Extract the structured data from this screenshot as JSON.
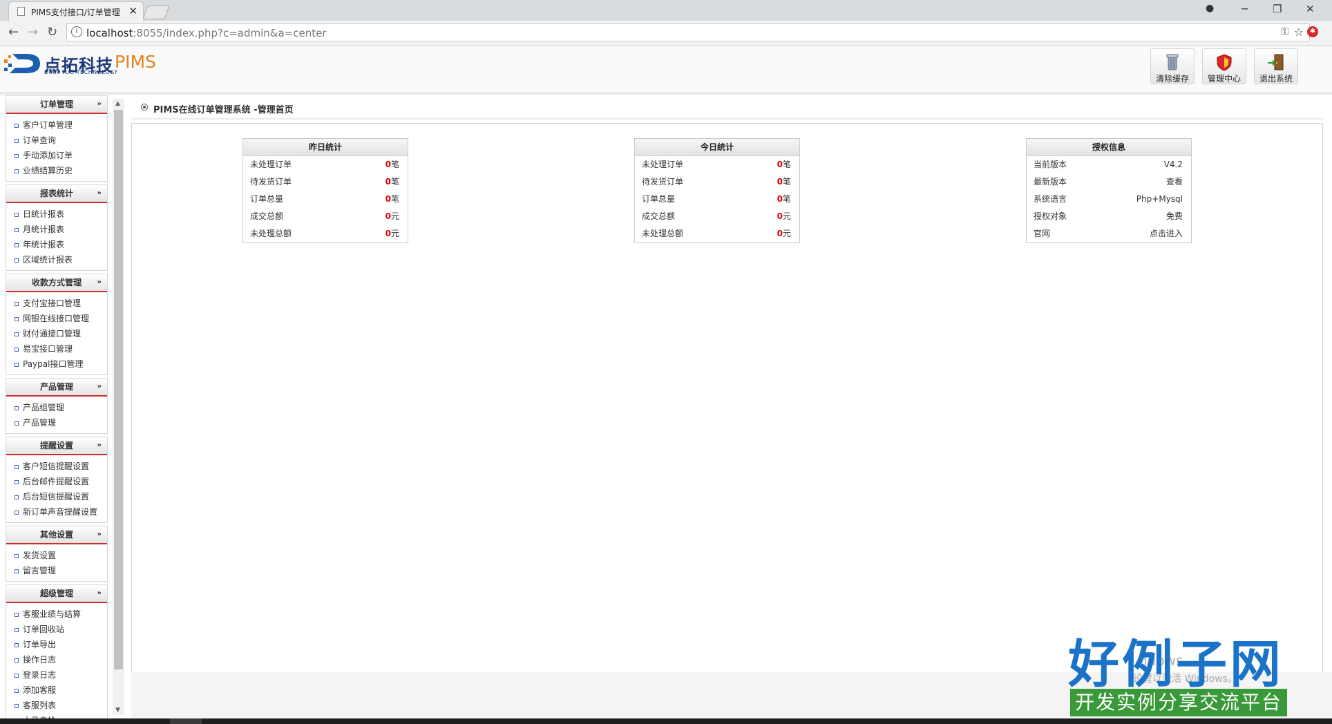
{
  "browser": {
    "tab_title": "PIMS支付接口/订单管理",
    "tab_close": "✕",
    "url_host": "localhost",
    "url_rest": ":8055/index.php?c=admin&a=center",
    "win_min": "─",
    "win_max": "❐",
    "win_close": "✕",
    "back": "←",
    "forward": "→",
    "reload": "↻",
    "info": "i",
    "key": "⚿",
    "star": "☆",
    "ext": "✱"
  },
  "header": {
    "logo_cn": "点拓科技",
    "logo_pims": "PIMS",
    "logo_en": "DIAN TUO TECHNOLOGY",
    "buttons": [
      {
        "label": "清除缓存",
        "icon": "trash-icon"
      },
      {
        "label": "管理中心",
        "icon": "shield-icon"
      },
      {
        "label": "退出系统",
        "icon": "exit-door-icon"
      }
    ]
  },
  "sidebar": {
    "groups": [
      {
        "title": "订单管理",
        "items": [
          "客户订单管理",
          "订单查询",
          "手动添加订单",
          "业绩结算历史"
        ]
      },
      {
        "title": "报表统计",
        "items": [
          "日统计报表",
          "月统计报表",
          "年统计报表",
          "区域统计报表"
        ]
      },
      {
        "title": "收款方式管理",
        "items": [
          "支付宝接口管理",
          "网银在线接口管理",
          "财付通接口管理",
          "易宝接口管理",
          "Paypal接口管理"
        ]
      },
      {
        "title": "产品管理",
        "items": [
          "产品组管理",
          "产品管理"
        ]
      },
      {
        "title": "提醒设置",
        "items": [
          "客户短信提醒设置",
          "后台邮件提醒设置",
          "后台短信提醒设置",
          "新订单声音提醒设置"
        ]
      },
      {
        "title": "其他设置",
        "items": [
          "发货设置",
          "留言管理"
        ]
      },
      {
        "title": "超级管理",
        "items": [
          "客服业绩与结算",
          "订单回收站",
          "订单导出",
          "操作日志",
          "登录日志",
          "添加客服",
          "客服列表",
          "木马自检"
        ]
      }
    ],
    "arrow": "»"
  },
  "main": {
    "breadcrumb": "PIMS在线订单管理系统 -管理首页",
    "yesterday": {
      "title": "昨日统计",
      "rows": [
        {
          "label": "未处理订单",
          "num": "0",
          "unit": "笔"
        },
        {
          "label": "待发货订单",
          "num": "0",
          "unit": "笔"
        },
        {
          "label": "订单总量",
          "num": "0",
          "unit": "笔"
        },
        {
          "label": "成交总额",
          "num": "0",
          "unit": "元"
        },
        {
          "label": "未处理总额",
          "num": "0",
          "unit": "元"
        }
      ]
    },
    "today": {
      "title": "今日统计",
      "rows": [
        {
          "label": "未处理订单",
          "num": "0",
          "unit": "笔"
        },
        {
          "label": "待发货订单",
          "num": "0",
          "unit": "笔"
        },
        {
          "label": "订单总量",
          "num": "0",
          "unit": "笔"
        },
        {
          "label": "成交总额",
          "num": "0",
          "unit": "元"
        },
        {
          "label": "未处理总额",
          "num": "0",
          "unit": "元"
        }
      ]
    },
    "license": {
      "title": "授权信息",
      "rows": [
        {
          "label": "当前版本",
          "value": "V4.2"
        },
        {
          "label": "最新版本",
          "value": "查看"
        },
        {
          "label": "系统语言",
          "value": "Php+Mysql"
        },
        {
          "label": "授权对象",
          "value": "免费"
        },
        {
          "label": "官网",
          "value": "点击进入"
        }
      ]
    }
  },
  "watermark": {
    "brand": "好例子网",
    "slogan": "开发实例分享交流平台",
    "win_line1": "ndows",
    "win_line2": "设置以激活 Windows。"
  },
  "colors": {
    "accent_red": "#c9302c",
    "value_red": "#e00000",
    "logo_blue": "#1c3a7a",
    "logo_orange": "#e8801a"
  }
}
